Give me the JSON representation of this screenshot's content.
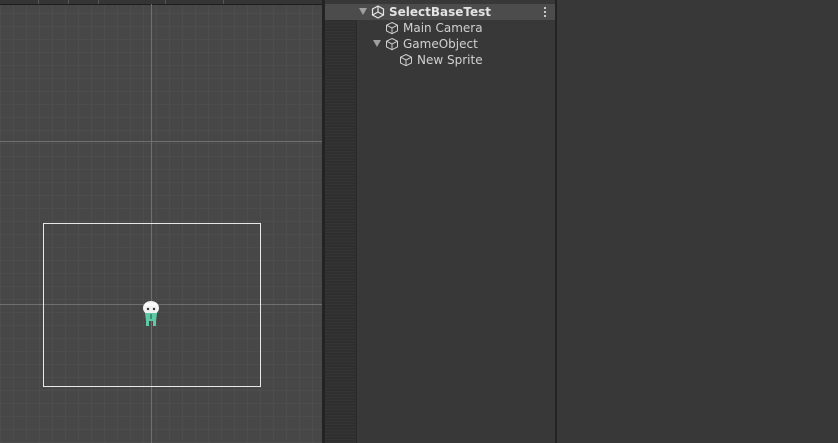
{
  "scene_view": {
    "toolbar_separators": 5
  },
  "hierarchy": {
    "scene": {
      "label": "SelectBaseTest",
      "icon": "unity-logo-icon",
      "expanded": true
    },
    "items": [
      {
        "label": "Main Camera",
        "icon": "gameobject-cube-icon",
        "depth": 1,
        "has_children": false
      },
      {
        "label": "GameObject",
        "icon": "gameobject-cube-icon",
        "depth": 1,
        "has_children": true,
        "expanded": true
      },
      {
        "label": "New Sprite",
        "icon": "gameobject-cube-icon",
        "depth": 2,
        "has_children": false
      }
    ]
  },
  "colors": {
    "scene_background": "#474747",
    "panel_background": "#383838",
    "camera_frame": "#e8e8e8",
    "sprite_accent": "#5fc9a6"
  }
}
